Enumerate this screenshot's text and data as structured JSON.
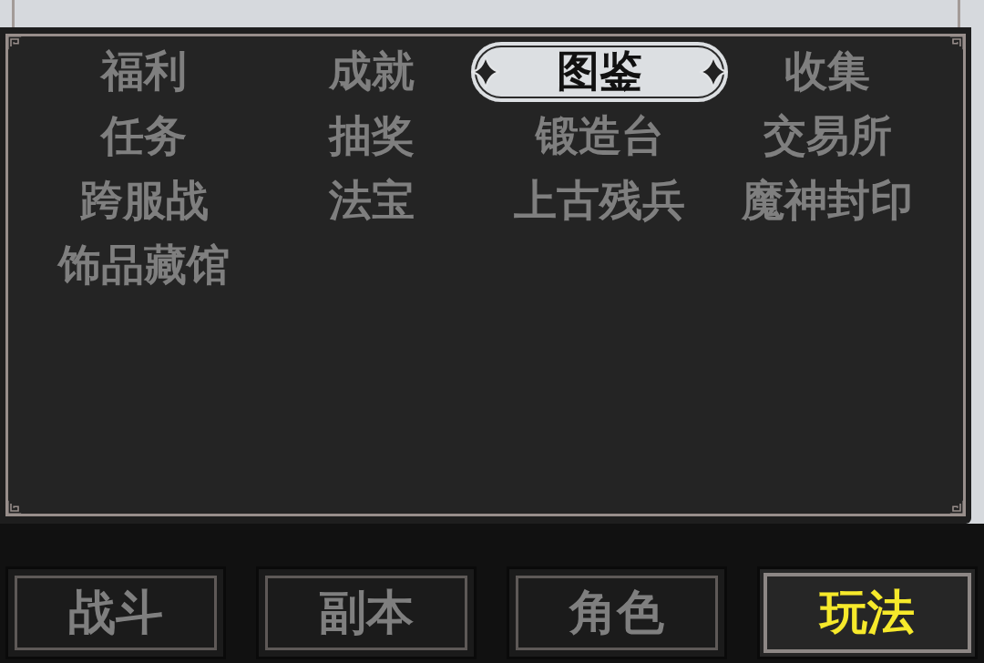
{
  "menu": {
    "items": [
      {
        "label": "福利",
        "selected": false
      },
      {
        "label": "成就",
        "selected": false
      },
      {
        "label": "图鉴",
        "selected": true
      },
      {
        "label": "收集",
        "selected": false
      },
      {
        "label": "任务",
        "selected": false
      },
      {
        "label": "抽奖",
        "selected": false
      },
      {
        "label": "锻造台",
        "selected": false
      },
      {
        "label": "交易所",
        "selected": false
      },
      {
        "label": "跨服战",
        "selected": false
      },
      {
        "label": "法宝",
        "selected": false
      },
      {
        "label": "上古残兵",
        "selected": false
      },
      {
        "label": "魔神封印",
        "selected": false
      },
      {
        "label": "饰品藏馆",
        "selected": false
      }
    ]
  },
  "bottom_tabs": [
    {
      "label": "战斗",
      "selected": false
    },
    {
      "label": "副本",
      "selected": false
    },
    {
      "label": "角色",
      "selected": false
    },
    {
      "label": "玩法",
      "selected": true
    }
  ]
}
